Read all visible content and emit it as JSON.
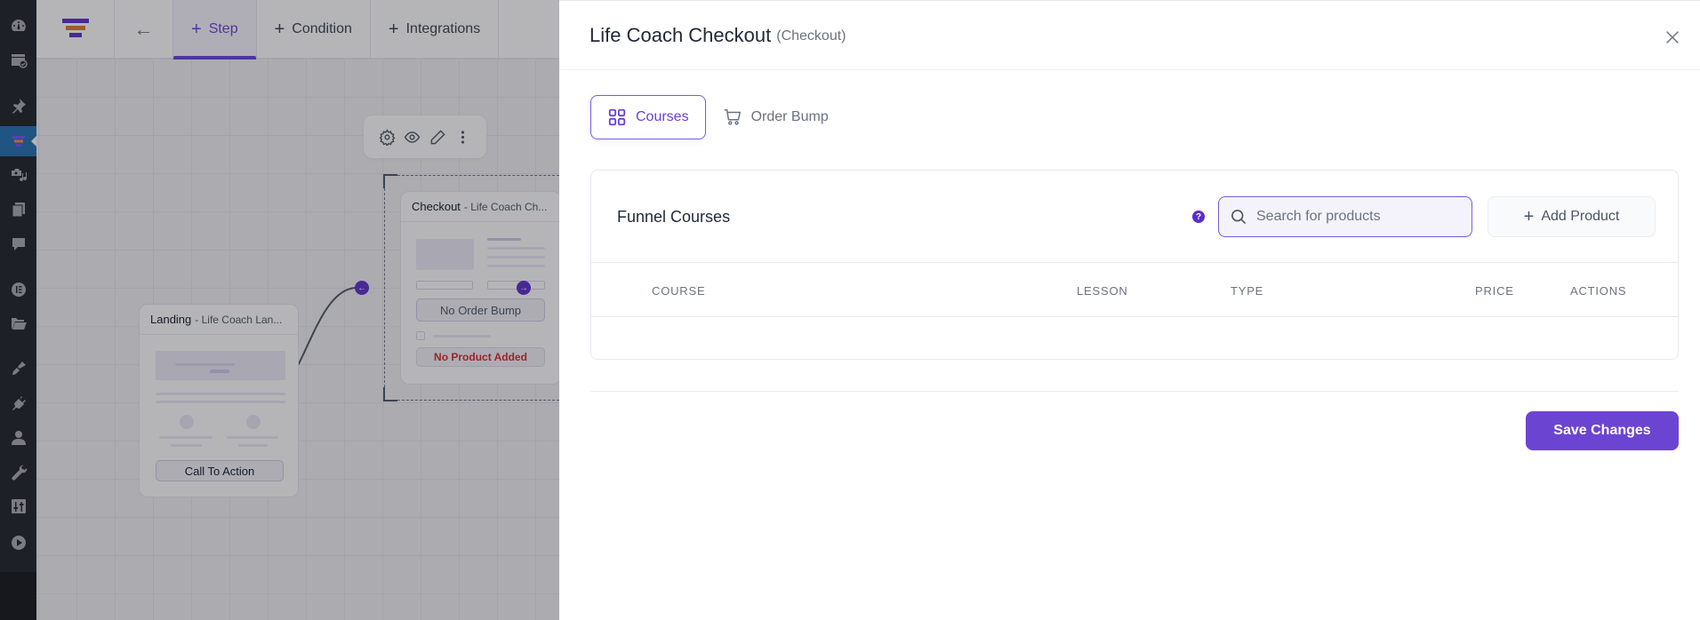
{
  "wp_sidebar": {
    "items": [
      {
        "icon": "dashboard-icon"
      },
      {
        "icon": "site-check-icon"
      },
      {
        "icon": "pin-icon"
      },
      {
        "icon": "funnel-icon",
        "active": true
      },
      {
        "icon": "media-icon"
      },
      {
        "icon": "pages-icon"
      },
      {
        "icon": "comments-icon"
      },
      {
        "icon": "elementor-icon"
      },
      {
        "icon": "folder-icon"
      },
      {
        "icon": "appearance-icon"
      },
      {
        "icon": "plugins-icon"
      },
      {
        "icon": "users-icon"
      },
      {
        "icon": "tools-icon"
      },
      {
        "icon": "settings-icon"
      },
      {
        "icon": "play-icon"
      }
    ]
  },
  "builder": {
    "tabs": [
      {
        "label": "Step",
        "active": true
      },
      {
        "label": "Condition"
      },
      {
        "label": "Integrations"
      }
    ],
    "nodes": {
      "landing": {
        "type": "Landing",
        "name": "- Life Coach Lan...",
        "button": "Call To Action"
      },
      "checkout": {
        "type": "Checkout",
        "name": "- Life Coach Ch...",
        "order_bump": "No Order Bump",
        "product_status": "No Product Added"
      }
    }
  },
  "panel": {
    "title": "Life Coach Checkout",
    "subtitle": "(Checkout)",
    "tabs": [
      {
        "label": "Courses",
        "icon": "grid-icon",
        "active": true
      },
      {
        "label": "Order Bump",
        "icon": "cart-icon"
      }
    ],
    "card": {
      "title": "Funnel Courses",
      "search_placeholder": "Search for products",
      "search_value": "",
      "add_product_label": "Add Product",
      "columns": [
        "COURSE",
        "LESSON",
        "TYPE",
        "PRICE",
        "ACTIONS"
      ],
      "rows": []
    },
    "save_label": "Save Changes"
  },
  "colors": {
    "accent": "#6741d9",
    "button": "#6c44d2",
    "error": "#dc2626",
    "wp_active": "#2271b1"
  }
}
